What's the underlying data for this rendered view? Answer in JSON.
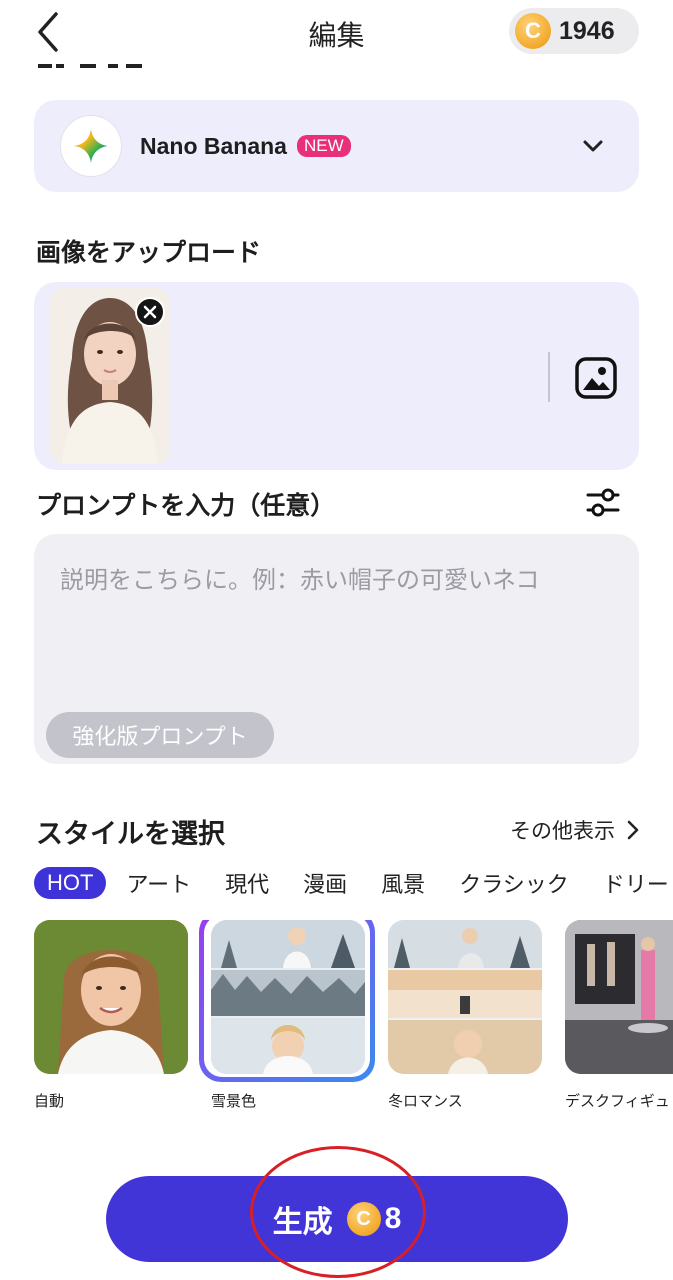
{
  "header": {
    "title": "編集",
    "coin_symbol": "C",
    "coin_balance": "1946"
  },
  "model": {
    "name": "Nano Banana",
    "badge": "NEW"
  },
  "upload": {
    "title": "画像をアップロード"
  },
  "prompt": {
    "title": "プロンプトを入力（任意）",
    "placeholder": "説明をこちらに。例：赤い帽子の可愛いネコ",
    "enhance_label": "強化版プロンプト"
  },
  "styles": {
    "title": "スタイルを選択",
    "more_label": "その他表示",
    "tabs": [
      "HOT",
      "アート",
      "現代",
      "漫画",
      "風景",
      "クラシック",
      "ドリー"
    ],
    "items": [
      {
        "label": "自動"
      },
      {
        "label": "雪景色"
      },
      {
        "label": "冬ロマンス"
      },
      {
        "label": "デスクフィギュ"
      }
    ]
  },
  "generate": {
    "label": "生成",
    "coin_symbol": "C",
    "cost": "8"
  },
  "colors": {
    "accent": "#4235d8",
    "card_bg": "#eeedfc",
    "new_badge": "#e8307a",
    "annotation": "#d81f26"
  }
}
